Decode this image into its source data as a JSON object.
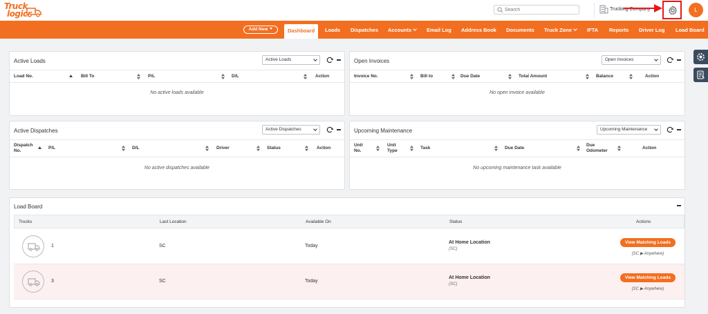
{
  "header": {
    "logo_line1": "Truck",
    "logo_line2": "logics",
    "search_placeholder": "Search",
    "company_name": "Trucking Company",
    "avatar_initial": "L",
    "accent_color": "#f26f21",
    "highlight_color": "#e8161b"
  },
  "nav": {
    "add_new": "Add New",
    "items": [
      {
        "label": "Dashboard",
        "active": true
      },
      {
        "label": "Loads"
      },
      {
        "label": "Dispatches"
      },
      {
        "label": "Accounts",
        "dropdown": true
      },
      {
        "label": "Email Log"
      },
      {
        "label": "Address Book"
      },
      {
        "label": "Documents"
      },
      {
        "label": "Truck Zone",
        "dropdown": true
      },
      {
        "label": "IFTA"
      },
      {
        "label": "Reports"
      },
      {
        "label": "Driver Log"
      },
      {
        "label": "Load Board"
      }
    ]
  },
  "active_loads": {
    "title": "Active Loads",
    "select_value": "Active Loads",
    "columns": [
      "Load No.",
      "Bill To",
      "P/L",
      "D/L",
      "Action"
    ],
    "empty": "No active loads available"
  },
  "open_invoices": {
    "title": "Open Invoices",
    "select_value": "Open Invoices",
    "columns": [
      "Invoice No.",
      "Bill to",
      "Due Date",
      "Total Amount",
      "Balance",
      "Action"
    ],
    "empty": "No open invoice available"
  },
  "active_dispatches": {
    "title": "Active Dispatches",
    "select_value": "Active Dispatches",
    "columns": [
      "Dispatch",
      "No.",
      "P/L",
      "D/L",
      "Driver",
      "Status",
      "Action"
    ],
    "empty": "No active dispatches available"
  },
  "upcoming_maintenance": {
    "title": "Upcoming Maintenance",
    "select_value": "Upcoming Maintenance",
    "columns": [
      "Unit",
      "No.",
      "Unit",
      "Type",
      "Task",
      "Due Date",
      "Due",
      "Odometer",
      "Action"
    ],
    "empty": "No upcoming maintenance task available"
  },
  "load_board": {
    "title": "Load Board",
    "columns": [
      "Trucks",
      "Last Location",
      "Available On",
      "Status",
      "Actions"
    ],
    "rows": [
      {
        "truck": "1",
        "location": "SC",
        "available": "Today",
        "status": "At Home Location",
        "status_sub": "(SC)",
        "button": "View Matching Loads",
        "route": "(SC ▶ Anywhere)"
      },
      {
        "truck": "3",
        "location": "SC",
        "available": "Today",
        "status": "At Home Location",
        "status_sub": "(SC)",
        "button": "View Matching Loads",
        "route": "(SC ▶ Anywhere)"
      }
    ]
  },
  "icons": [
    "truck-logo-icon",
    "search-icon",
    "building-icon",
    "arrow-icon",
    "gear-icon",
    "refresh-icon",
    "collapse-icon",
    "sort-icon",
    "truck-icon",
    "settings-side-icon",
    "document-side-icon"
  ]
}
